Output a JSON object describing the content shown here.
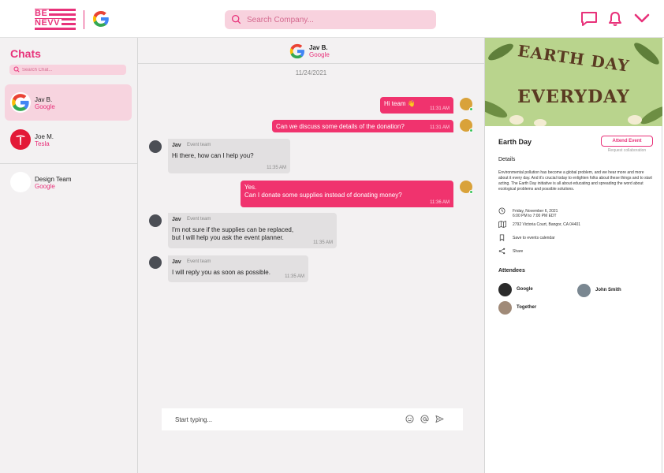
{
  "brand": {
    "logo_top": "BE",
    "logo_bottom": "NEVV",
    "accent": "#e8327a",
    "pink_light": "#f8d2de"
  },
  "header": {
    "search_placeholder": "Search Company...",
    "icons": [
      "chat-icon",
      "bell-icon",
      "chevron-down-icon"
    ]
  },
  "sidebar": {
    "title": "Chats",
    "search_placeholder": "Search Chat...",
    "items": [
      {
        "name": "Jav B.",
        "company": "Google",
        "icon": "google-logo",
        "active": true
      },
      {
        "name": "Joe M.",
        "company": "Tesla",
        "icon": "tesla-logo",
        "active": false
      },
      {
        "name": "Design Team",
        "company": "Google",
        "icon": "group-avatar",
        "active": false
      }
    ]
  },
  "conversation": {
    "header": {
      "name": "Jav B.",
      "company": "Google"
    },
    "date": "11/24/2021",
    "messages": [
      {
        "direction": "out",
        "text": "Hi team 👋",
        "time": "11:31 AM"
      },
      {
        "direction": "out",
        "text": "Can we discuss some details of the donation?",
        "time": "11:31 AM"
      },
      {
        "direction": "in",
        "sender": "Jav",
        "role": "Event team",
        "text": "Hi there, how can I help you?",
        "time": "11:35 AM"
      },
      {
        "direction": "out",
        "text": "Yes.\nCan I donate some supplies instead of donating money?",
        "time": "11:36 AM"
      },
      {
        "direction": "in",
        "sender": "Jav",
        "role": "Event team",
        "text": "I'm not sure if the supplies can be replaced,\nbut I will help you ask the event planner.",
        "time": "11:35 AM"
      },
      {
        "direction": "in",
        "sender": "Jav",
        "role": "Event team",
        "text": "I will reply you as soon as possible.",
        "time": "11:35 AM"
      }
    ],
    "composer_placeholder": "Start typing..."
  },
  "event": {
    "banner_line1": "EARTH DAY",
    "banner_line2": "EVERYDAY",
    "title": "Earth Day",
    "attend_label": "Attend Event",
    "collab_label": "Request collaboration",
    "details_heading": "Details",
    "description": "Environmental pollution has become a global problem, and we hear more and more about it every day. And it's crucial today to enlighten folks about these things and to start acting. The Earth Day initiative is all about educating and spreading the word about ecological problems and possible solutions.",
    "date_line1": "Friday, November 6, 2021",
    "date_line2": "6:00 PM to 7:00 PM EDT",
    "address": "2792 Victoria Court, Bangor, CA 04401",
    "save_label": "Save to events calendar",
    "share_label": "Share",
    "attendees_heading": "Attendees",
    "attendees": [
      {
        "name": "Google"
      },
      {
        "name": "John Smith"
      },
      {
        "name": "Together"
      }
    ]
  }
}
